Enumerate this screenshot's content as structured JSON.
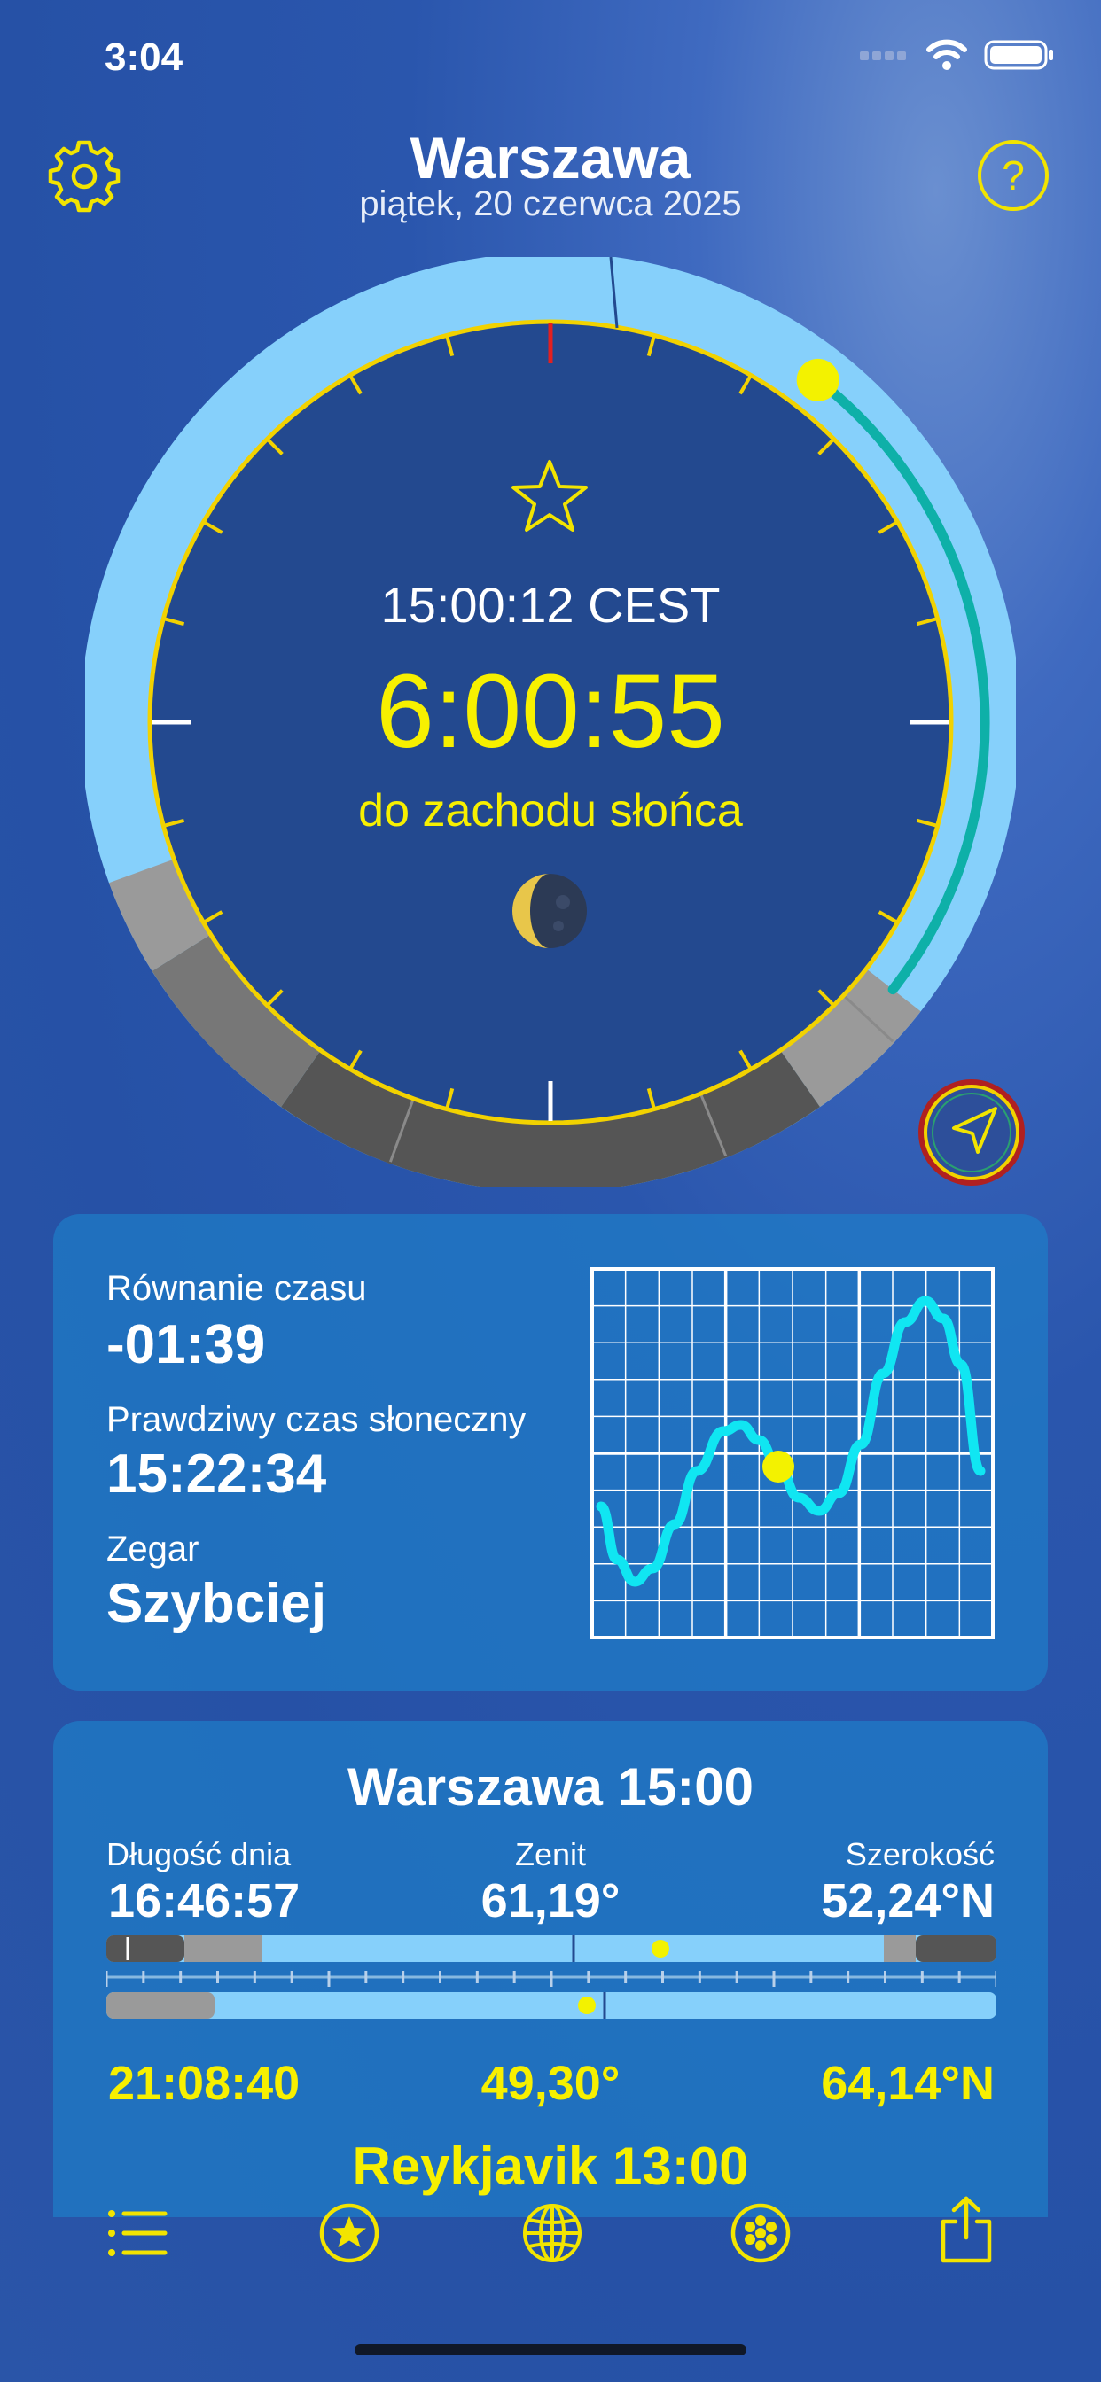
{
  "status": {
    "time": "3:04"
  },
  "header": {
    "city": "Warszawa",
    "date": "piątek, 20 czerwca 2025"
  },
  "icons": {
    "settings": "gear-icon",
    "help": "question-mark-icon",
    "favorite": "star-outline-icon",
    "moon": "moon-phase-icon",
    "location": "location-arrow-icon"
  },
  "clock": {
    "local_time": "15:00:12 CEST",
    "countdown": "6:00:55",
    "countdown_label": "do zachodu słońca"
  },
  "equation_card": {
    "eq_label": "Równanie czasu",
    "eq_value": "-01:39",
    "solar_label": "Prawdziwy czas słoneczny",
    "solar_value": "15:22:34",
    "clock_label": "Zegar",
    "clock_value": "Szybciej"
  },
  "compare_card": {
    "city1_title": "Warszawa 15:00",
    "day_length_label": "Długość dnia",
    "zenith_label": "Zenit",
    "latitude_label": "Szerokość",
    "city1_day_length": "16:46:57",
    "city1_zenith": "61,19°",
    "city1_latitude": "52,24°N",
    "city2_day_length": "21:08:40",
    "city2_zenith": "49,30°",
    "city2_latitude": "64,14°N",
    "city2_title": "Reykjavik 13:00"
  },
  "tabbar": {
    "items": [
      "list-icon",
      "star-circle-icon",
      "globe-icon",
      "flower-circle-icon",
      "share-icon"
    ]
  },
  "colors": {
    "accent_yellow": "#f7f000",
    "day_blue": "#86d0fb",
    "night_gray": "#555555",
    "twilight_gray": "#9a9a9a",
    "teal_track": "#0eb0a8",
    "graph_cyan": "#10e6f2"
  }
}
